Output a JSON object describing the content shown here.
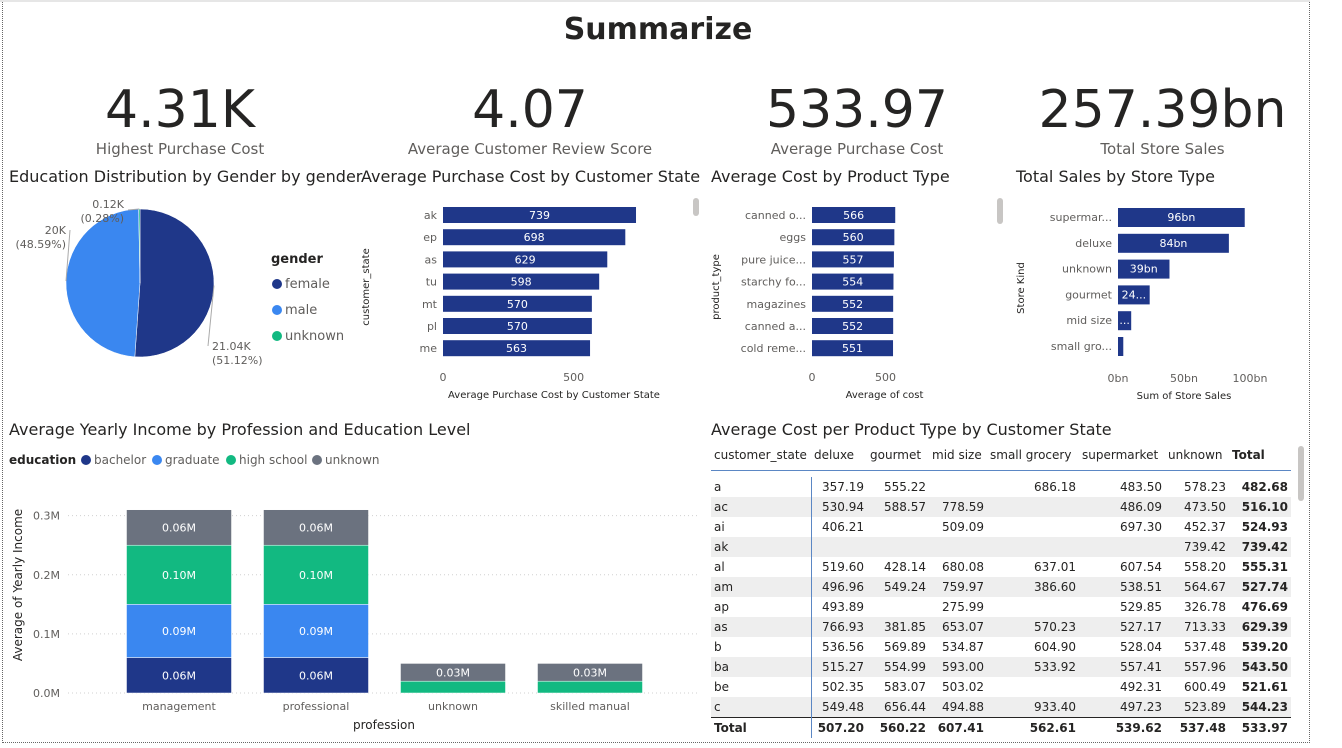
{
  "page_title": "Summarize",
  "kpis": [
    {
      "value": "4.31K",
      "label": "Highest Purchase Cost"
    },
    {
      "value": "4.07",
      "label": "Average Customer Review Score"
    },
    {
      "value": "533.97",
      "label": "Average Purchase Cost"
    },
    {
      "value": "257.39bn",
      "label": "Total Store Sales"
    }
  ],
  "visuals": {
    "pie_title": "Education Distribution by Gender by gender",
    "bar1_title": "Average Purchase Cost by Customer State",
    "bar2_title": "Average Cost by Product Type",
    "bar3_title": "Total Sales by Store Type",
    "stack_title": "Average Yearly Income by Profession and Education Level",
    "table_title": "Average Cost per Product Type by Customer State"
  },
  "colors": {
    "navy": "#1f3789",
    "blue": "#3a87f0",
    "green": "#12b981",
    "gray": "#6b727f"
  },
  "chart_data": [
    {
      "type": "pie",
      "title": "Education Distribution by Gender by gender",
      "legend_title": "gender",
      "legend_position": "right",
      "slices": [
        {
          "name": "female",
          "value": 21040,
          "label": "21.04K",
          "pct": "(51.12%)",
          "color": "#1f3789"
        },
        {
          "name": "male",
          "value": 20000,
          "label": "20K",
          "pct": "(48.59%)",
          "color": "#3a87f0"
        },
        {
          "name": "unknown",
          "value": 120,
          "label": "0.12K",
          "pct": "(0.28%)",
          "color": "#12b981"
        }
      ]
    },
    {
      "type": "bar",
      "orientation": "horizontal",
      "title": "Average Purchase Cost by Customer State",
      "xlabel": "Average Purchase Cost by Customer State",
      "ylabel": "customer_state",
      "categories": [
        "ak",
        "ep",
        "as",
        "tu",
        "mt",
        "pl",
        "me"
      ],
      "values": [
        739,
        698,
        629,
        598,
        570,
        570,
        563
      ],
      "data_labels": [
        "739",
        "698",
        "629",
        "598",
        "570",
        "570",
        "563"
      ],
      "ticks": [
        "0",
        "500"
      ],
      "xlim": [
        0,
        850
      ]
    },
    {
      "type": "bar",
      "orientation": "horizontal",
      "title": "Average Cost by Product Type",
      "xlabel": "Average of cost",
      "ylabel": "product_type",
      "categories": [
        "canned o...",
        "eggs",
        "pure juice...",
        "starchy fo...",
        "magazines",
        "canned a...",
        "cold reme..."
      ],
      "values": [
        566,
        560,
        557,
        554,
        552,
        552,
        551
      ],
      "data_labels": [
        "566",
        "560",
        "557",
        "554",
        "552",
        "552",
        "551"
      ],
      "ticks": [
        "0",
        "500"
      ],
      "xlim": [
        0,
        850
      ]
    },
    {
      "type": "bar",
      "orientation": "horizontal",
      "title": "Total Sales by Store Type",
      "xlabel": "Sum of Store Sales",
      "ylabel": "Store Kind",
      "categories": [
        "supermar...",
        "deluxe",
        "unknown",
        "gourmet",
        "mid size",
        "small gro..."
      ],
      "values": [
        96,
        84,
        39,
        24,
        10,
        4
      ],
      "data_labels": [
        "96bn",
        "84bn",
        "39bn",
        "24...",
        "...",
        ""
      ],
      "ticks": [
        "0bn",
        "50bn",
        "100bn"
      ],
      "xlim": [
        0,
        100
      ]
    },
    {
      "type": "bar",
      "stacked": true,
      "title": "Average Yearly Income by Profession and Education Level",
      "xlabel": "profession",
      "ylabel": "Average of Yearly Income",
      "legend_title": "education",
      "legend_position": "top-left",
      "categories": [
        "management",
        "professional",
        "unknown",
        "skilled manual"
      ],
      "ticks": [
        "0.0M",
        "0.1M",
        "0.2M",
        "0.3M"
      ],
      "ylim": [
        0,
        0.34
      ],
      "series": [
        {
          "name": "bachelor",
          "color": "#1f3789",
          "values": [
            0.06,
            0.06,
            0,
            0
          ],
          "labels": [
            "0.06M",
            "0.06M",
            "",
            ""
          ]
        },
        {
          "name": "graduate",
          "color": "#3a87f0",
          "values": [
            0.09,
            0.09,
            0,
            0
          ],
          "labels": [
            "0.09M",
            "0.09M",
            "",
            ""
          ]
        },
        {
          "name": "high school",
          "color": "#12b981",
          "values": [
            0.1,
            0.1,
            0.02,
            0.02
          ],
          "labels": [
            "0.10M",
            "0.10M",
            "",
            ""
          ]
        },
        {
          "name": "unknown",
          "color": "#6b727f",
          "values": [
            0.06,
            0.06,
            0.03,
            0.03
          ],
          "labels": [
            "0.06M",
            "0.06M",
            "0.03M",
            "0.03M"
          ]
        }
      ]
    },
    {
      "type": "table",
      "title": "Average Cost per Product Type by Customer State",
      "columns": [
        "customer_state",
        "deluxe",
        "gourmet",
        "mid size",
        "small grocery",
        "supermarket",
        "unknown",
        "Total"
      ],
      "rows": [
        [
          "a",
          "357.19",
          "555.22",
          "",
          "686.18",
          "483.50",
          "578.23",
          "482.68"
        ],
        [
          "ac",
          "530.94",
          "588.57",
          "778.59",
          "",
          "486.09",
          "473.50",
          "516.10"
        ],
        [
          "ai",
          "406.21",
          "",
          "509.09",
          "",
          "697.30",
          "452.37",
          "524.93"
        ],
        [
          "ak",
          "",
          "",
          "",
          "",
          "",
          "739.42",
          "739.42"
        ],
        [
          "al",
          "519.60",
          "428.14",
          "680.08",
          "637.01",
          "607.54",
          "558.20",
          "555.31"
        ],
        [
          "am",
          "496.96",
          "549.24",
          "759.97",
          "386.60",
          "538.51",
          "564.67",
          "527.74"
        ],
        [
          "ap",
          "493.89",
          "",
          "275.99",
          "",
          "529.85",
          "326.78",
          "476.69"
        ],
        [
          "as",
          "766.93",
          "381.85",
          "653.07",
          "570.23",
          "527.17",
          "713.33",
          "629.39"
        ],
        [
          "b",
          "536.56",
          "569.89",
          "534.87",
          "604.90",
          "528.04",
          "537.48",
          "539.20"
        ],
        [
          "ba",
          "515.27",
          "554.99",
          "593.00",
          "533.92",
          "557.41",
          "557.96",
          "543.50"
        ],
        [
          "be",
          "502.35",
          "583.07",
          "503.02",
          "",
          "492.31",
          "600.49",
          "521.61"
        ],
        [
          "c",
          "549.48",
          "656.44",
          "494.88",
          "933.40",
          "497.23",
          "523.89",
          "544.23"
        ]
      ],
      "total_row": [
        "Total",
        "507.20",
        "560.22",
        "607.41",
        "562.61",
        "539.62",
        "537.48",
        "533.97"
      ]
    }
  ]
}
